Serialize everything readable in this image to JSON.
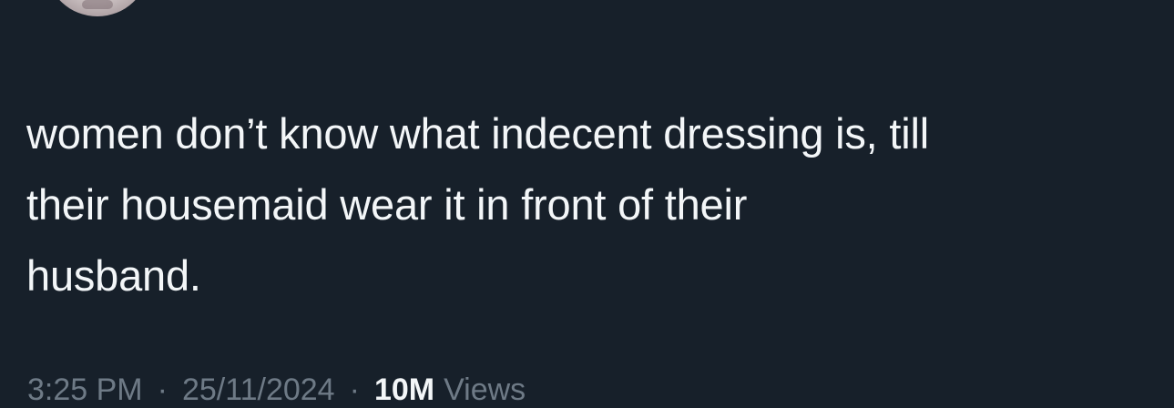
{
  "tweet": {
    "lines": [
      "women don’t know what indecent dressing is, till",
      "their housemaid wear it in front of their",
      "husband."
    ]
  },
  "meta": {
    "time": "3:25 PM",
    "separator": "·",
    "date": "25/11/2024",
    "views_count": "10M",
    "views_label": "Views"
  },
  "colors": {
    "background": "#17202a",
    "text": "#f3f6f8",
    "secondary_text": "#6e7a86"
  }
}
